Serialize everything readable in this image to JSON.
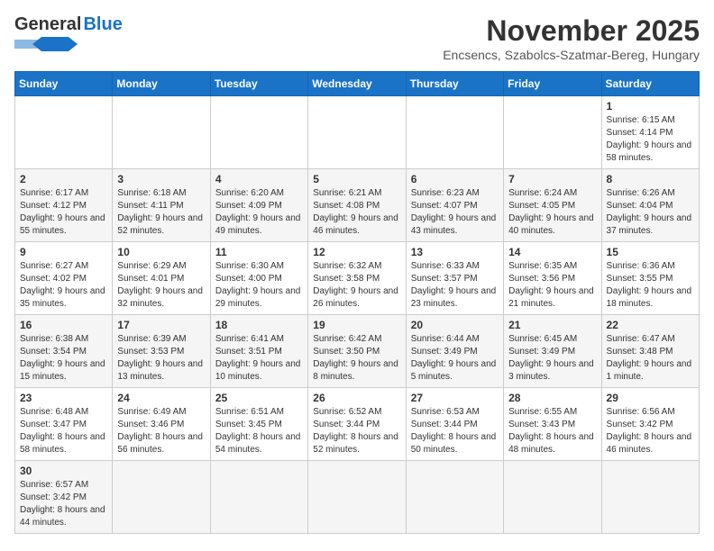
{
  "header": {
    "logo_general": "General",
    "logo_blue": "Blue",
    "month_title": "November 2025",
    "location": "Encsencs, Szabolcs-Szatmar-Bereg, Hungary"
  },
  "weekdays": [
    "Sunday",
    "Monday",
    "Tuesday",
    "Wednesday",
    "Thursday",
    "Friday",
    "Saturday"
  ],
  "weeks": [
    [
      {
        "day": "",
        "info": ""
      },
      {
        "day": "",
        "info": ""
      },
      {
        "day": "",
        "info": ""
      },
      {
        "day": "",
        "info": ""
      },
      {
        "day": "",
        "info": ""
      },
      {
        "day": "",
        "info": ""
      },
      {
        "day": "1",
        "info": "Sunrise: 6:15 AM\nSunset: 4:14 PM\nDaylight: 9 hours and 58 minutes."
      }
    ],
    [
      {
        "day": "2",
        "info": "Sunrise: 6:17 AM\nSunset: 4:12 PM\nDaylight: 9 hours and 55 minutes."
      },
      {
        "day": "3",
        "info": "Sunrise: 6:18 AM\nSunset: 4:11 PM\nDaylight: 9 hours and 52 minutes."
      },
      {
        "day": "4",
        "info": "Sunrise: 6:20 AM\nSunset: 4:09 PM\nDaylight: 9 hours and 49 minutes."
      },
      {
        "day": "5",
        "info": "Sunrise: 6:21 AM\nSunset: 4:08 PM\nDaylight: 9 hours and 46 minutes."
      },
      {
        "day": "6",
        "info": "Sunrise: 6:23 AM\nSunset: 4:07 PM\nDaylight: 9 hours and 43 minutes."
      },
      {
        "day": "7",
        "info": "Sunrise: 6:24 AM\nSunset: 4:05 PM\nDaylight: 9 hours and 40 minutes."
      },
      {
        "day": "8",
        "info": "Sunrise: 6:26 AM\nSunset: 4:04 PM\nDaylight: 9 hours and 37 minutes."
      }
    ],
    [
      {
        "day": "9",
        "info": "Sunrise: 6:27 AM\nSunset: 4:02 PM\nDaylight: 9 hours and 35 minutes."
      },
      {
        "day": "10",
        "info": "Sunrise: 6:29 AM\nSunset: 4:01 PM\nDaylight: 9 hours and 32 minutes."
      },
      {
        "day": "11",
        "info": "Sunrise: 6:30 AM\nSunset: 4:00 PM\nDaylight: 9 hours and 29 minutes."
      },
      {
        "day": "12",
        "info": "Sunrise: 6:32 AM\nSunset: 3:58 PM\nDaylight: 9 hours and 26 minutes."
      },
      {
        "day": "13",
        "info": "Sunrise: 6:33 AM\nSunset: 3:57 PM\nDaylight: 9 hours and 23 minutes."
      },
      {
        "day": "14",
        "info": "Sunrise: 6:35 AM\nSunset: 3:56 PM\nDaylight: 9 hours and 21 minutes."
      },
      {
        "day": "15",
        "info": "Sunrise: 6:36 AM\nSunset: 3:55 PM\nDaylight: 9 hours and 18 minutes."
      }
    ],
    [
      {
        "day": "16",
        "info": "Sunrise: 6:38 AM\nSunset: 3:54 PM\nDaylight: 9 hours and 15 minutes."
      },
      {
        "day": "17",
        "info": "Sunrise: 6:39 AM\nSunset: 3:53 PM\nDaylight: 9 hours and 13 minutes."
      },
      {
        "day": "18",
        "info": "Sunrise: 6:41 AM\nSunset: 3:51 PM\nDaylight: 9 hours and 10 minutes."
      },
      {
        "day": "19",
        "info": "Sunrise: 6:42 AM\nSunset: 3:50 PM\nDaylight: 9 hours and 8 minutes."
      },
      {
        "day": "20",
        "info": "Sunrise: 6:44 AM\nSunset: 3:49 PM\nDaylight: 9 hours and 5 minutes."
      },
      {
        "day": "21",
        "info": "Sunrise: 6:45 AM\nSunset: 3:49 PM\nDaylight: 9 hours and 3 minutes."
      },
      {
        "day": "22",
        "info": "Sunrise: 6:47 AM\nSunset: 3:48 PM\nDaylight: 9 hours and 1 minute."
      }
    ],
    [
      {
        "day": "23",
        "info": "Sunrise: 6:48 AM\nSunset: 3:47 PM\nDaylight: 8 hours and 58 minutes."
      },
      {
        "day": "24",
        "info": "Sunrise: 6:49 AM\nSunset: 3:46 PM\nDaylight: 8 hours and 56 minutes."
      },
      {
        "day": "25",
        "info": "Sunrise: 6:51 AM\nSunset: 3:45 PM\nDaylight: 8 hours and 54 minutes."
      },
      {
        "day": "26",
        "info": "Sunrise: 6:52 AM\nSunset: 3:44 PM\nDaylight: 8 hours and 52 minutes."
      },
      {
        "day": "27",
        "info": "Sunrise: 6:53 AM\nSunset: 3:44 PM\nDaylight: 8 hours and 50 minutes."
      },
      {
        "day": "28",
        "info": "Sunrise: 6:55 AM\nSunset: 3:43 PM\nDaylight: 8 hours and 48 minutes."
      },
      {
        "day": "29",
        "info": "Sunrise: 6:56 AM\nSunset: 3:42 PM\nDaylight: 8 hours and 46 minutes."
      }
    ],
    [
      {
        "day": "30",
        "info": "Sunrise: 6:57 AM\nSunset: 3:42 PM\nDaylight: 8 hours and 44 minutes."
      },
      {
        "day": "",
        "info": ""
      },
      {
        "day": "",
        "info": ""
      },
      {
        "day": "",
        "info": ""
      },
      {
        "day": "",
        "info": ""
      },
      {
        "day": "",
        "info": ""
      },
      {
        "day": "",
        "info": ""
      }
    ]
  ],
  "row_styles": [
    "white",
    "shaded",
    "white",
    "shaded",
    "white",
    "shaded"
  ]
}
